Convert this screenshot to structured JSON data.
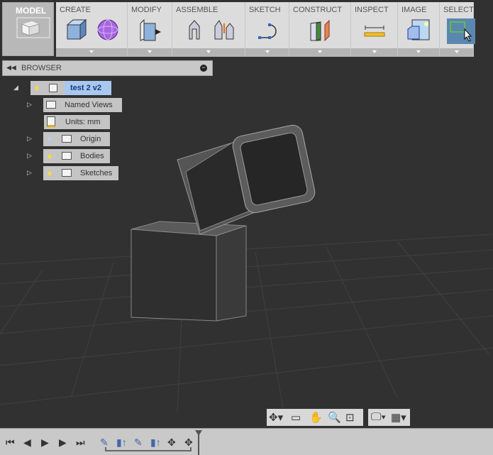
{
  "toolbar": {
    "model_label": "MODEL",
    "sections": [
      {
        "label": "CREATE"
      },
      {
        "label": "MODIFY"
      },
      {
        "label": "ASSEMBLE"
      },
      {
        "label": "SKETCH"
      },
      {
        "label": "CONSTRUCT"
      },
      {
        "label": "INSPECT"
      },
      {
        "label": "IMAGE"
      },
      {
        "label": "SELECT"
      }
    ]
  },
  "browser": {
    "title": "BROWSER",
    "root": "test 2 v2",
    "items": [
      {
        "label": "Named Views"
      },
      {
        "label": "Units: mm"
      },
      {
        "label": "Origin"
      },
      {
        "label": "Bodies"
      },
      {
        "label": "Sketches"
      }
    ]
  },
  "colors": {
    "accent": "#a9c8ee",
    "select_active": "#5a87b0"
  }
}
